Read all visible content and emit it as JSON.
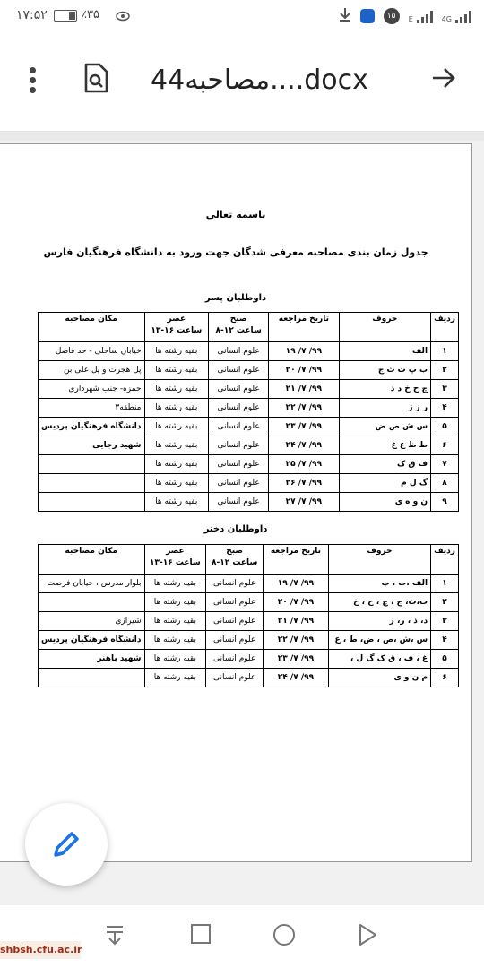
{
  "status_bar": {
    "time": "۱۷:۵۲",
    "battery": "٪۳۵",
    "notification_count": "۱۵",
    "network": "4G",
    "network_sub": "E"
  },
  "app_bar": {
    "title": "مصاحبه44....docx",
    "icons": [
      "overflow-menu-icon",
      "find-in-page-icon",
      "forward-arrow-icon"
    ]
  },
  "document": {
    "heading": "باسمه تعالی",
    "subtitle": "جدول زمان بندی  مصاحبه معرفی شدگان جهت ورود به دانشگاه فرهنگیان فارس",
    "boys_label": "داوطلبان پسر",
    "girls_label": "داوطلبان دختر",
    "headers": {
      "row": "ردیف",
      "letters": "حروف",
      "date": "تاریخ مراجعه",
      "morning": "صبح",
      "morning_time": "ساعت ۱۲-۸",
      "evening": "عصر",
      "evening_time": "ساعت ۱۶-۱۳",
      "place": "مکان مصاحبه"
    },
    "boys": [
      {
        "row": "۱",
        "letters": "الف",
        "date": "۹۹/ ۷/ ۱۹",
        "morning": "علوم انسانی",
        "evening": "بقیه رشته ها",
        "place": "خیابان ساحلی - حد فاصل"
      },
      {
        "row": "۲",
        "letters": "ب پ ت ث ج",
        "date": "۹۹/ ۷/ ۲۰",
        "morning": "علوم انسانی",
        "evening": "بقیه رشته ها",
        "place": "پل هجرت و پل علی بن"
      },
      {
        "row": "۳",
        "letters": "چ ح خ د ذ",
        "date": "۹۹/ ۷/ ۲۱",
        "morning": "علوم انسانی",
        "evening": "بقیه رشته ها",
        "place": "حمزه- جنب شهرداری"
      },
      {
        "row": "۴",
        "letters": "ر ز ژ",
        "date": "۹۹/ ۷/ ۲۲",
        "morning": "علوم انسانی",
        "evening": "بقیه رشته ها",
        "place": "منطقه۳"
      },
      {
        "row": "۵",
        "letters": "س ش ص ض",
        "date": "۹۹/ ۷/ ۲۳",
        "morning": "علوم انسانی",
        "evening": "بقیه رشته ها",
        "place": "دانشگاه فرهنگیان پردیس"
      },
      {
        "row": "۶",
        "letters": "ط ظ ع غ",
        "date": "۹۹/ ۷/ ۲۴",
        "morning": "علوم انسانی",
        "evening": "بقیه رشته ها",
        "place": "شهید رجایی"
      },
      {
        "row": "۷",
        "letters": "ف ق ک",
        "date": "۹۹/ ۷/ ۲۵",
        "morning": "علوم انسانی",
        "evening": "بقیه رشته ها",
        "place": ""
      },
      {
        "row": "۸",
        "letters": "گ ل م",
        "date": "۹۹/ ۷/ ۲۶",
        "morning": "علوم انسانی",
        "evening": "بقیه رشته ها",
        "place": ""
      },
      {
        "row": "۹",
        "letters": "ن و ه ی",
        "date": "۹۹/ ۷/ ۲۷",
        "morning": "علوم انسانی",
        "evening": "بقیه رشته ها",
        "place": ""
      }
    ],
    "girls": [
      {
        "row": "۱",
        "letters": "الف ،ب ، پ",
        "date": "۹۹/ ۷/ ۱۹",
        "morning": "علوم انسانی",
        "evening": "بقیه رشته ها",
        "place": "بلوار مدرس ، خیابان فرصت"
      },
      {
        "row": "۲",
        "letters": "ت،ث، ج ، چ ، ح ، خ",
        "date": "۹۹/ ۷/ ۲۰",
        "morning": "علوم انسانی",
        "evening": "بقیه رشته ها",
        "place": ""
      },
      {
        "row": "۳",
        "letters": "د، ذ ، ر، ز",
        "date": "۹۹/ ۷/ ۲۱",
        "morning": "علوم انسانی",
        "evening": "بقیه رشته ها",
        "place": "شیرازی"
      },
      {
        "row": "۴",
        "letters": "س ،ش ،ص ، ض، ط ، ع",
        "date": "۹۹/ ۷/ ۲۲",
        "morning": "علوم انسانی",
        "evening": "بقیه رشته ها",
        "place": "دانشگاه فرهنگیان پردیس"
      },
      {
        "row": "۵",
        "letters": "غ ، ف ، ق ک گ ل ،",
        "date": "۹۹/ ۷/ ۲۳",
        "morning": "علوم انسانی",
        "evening": "بقیه رشته ها",
        "place": "شهید باهنر"
      },
      {
        "row": "۶",
        "letters": "م ن و ی",
        "date": "۹۹/ ۷/ ۲۴",
        "morning": "علوم انسانی",
        "evening": "بقیه رشته ها",
        "place": ""
      }
    ]
  },
  "fab": {
    "icon": "edit-pencil-icon",
    "color": "#1a73e8"
  },
  "nav_bar": {
    "icons": [
      "download-menu-icon",
      "recents-square-icon",
      "home-circle-icon",
      "back-triangle-icon"
    ]
  },
  "watermark": "shbsh.cfu.ac.ir"
}
